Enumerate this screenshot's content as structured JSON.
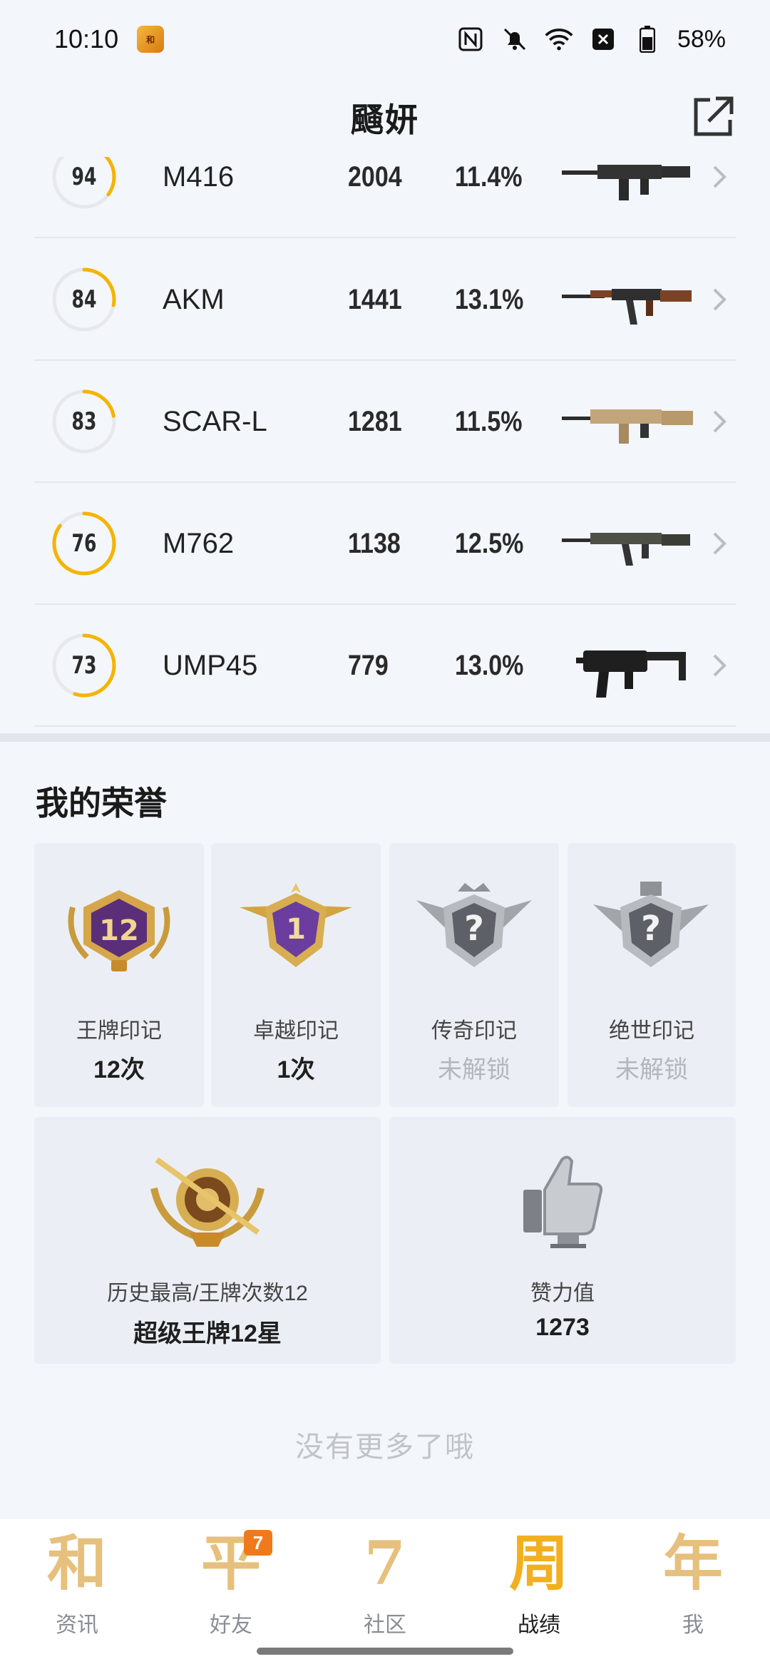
{
  "status": {
    "time": "10:10",
    "battery": "58%"
  },
  "header": {
    "title": "颾妍"
  },
  "weapons": [
    {
      "score": "94",
      "score_fraction": 0.35,
      "name": "M416",
      "kills": "2004",
      "rate": "11.4%",
      "gun": "assault-rifle-m416"
    },
    {
      "score": "84",
      "score_fraction": 0.28,
      "name": "AKM",
      "kills": "1441",
      "rate": "13.1%",
      "gun": "assault-rifle-akm"
    },
    {
      "score": "83",
      "score_fraction": 0.22,
      "name": "SCAR-L",
      "kills": "1281",
      "rate": "11.5%",
      "gun": "assault-rifle-scar"
    },
    {
      "score": "76",
      "score_fraction": 0.85,
      "name": "M762",
      "kills": "1138",
      "rate": "12.5%",
      "gun": "assault-rifle-m762"
    },
    {
      "score": "73",
      "score_fraction": 0.55,
      "name": "UMP45",
      "kills": "779",
      "rate": "13.0%",
      "gun": "smg-ump45"
    }
  ],
  "honors": {
    "title": "我的荣誉",
    "cards": [
      {
        "label": "王牌印记",
        "value": "12次",
        "badge_text": "12",
        "locked": false
      },
      {
        "label": "卓越印记",
        "value": "1次",
        "badge_text": "1",
        "locked": false
      },
      {
        "label": "传奇印记",
        "value": "未解锁",
        "badge_text": "?",
        "locked": true
      },
      {
        "label": "绝世印记",
        "value": "未解锁",
        "badge_text": "?",
        "locked": true
      }
    ],
    "wide_cards": [
      {
        "label": "历史最高/王牌次数12",
        "value": "超级王牌12星",
        "icon": "rank-badge-icon"
      },
      {
        "label": "赞力值",
        "value": "1273",
        "icon": "thumbs-up-icon"
      }
    ]
  },
  "footer_text": "没有更多了哦",
  "nav": {
    "items": [
      {
        "glyph": "和",
        "label": "资讯",
        "active": false
      },
      {
        "glyph": "平",
        "label": "好友",
        "active": false,
        "badge": "7"
      },
      {
        "glyph": "7",
        "label": "社区",
        "active": false
      },
      {
        "glyph": "周",
        "label": "战绩",
        "active": true
      },
      {
        "glyph": "年",
        "label": "我",
        "active": false
      }
    ]
  },
  "colors": {
    "accent": "#f5b400",
    "background": "#f3f6fb",
    "card": "#ebeff5",
    "badge": "#f07a1b"
  }
}
